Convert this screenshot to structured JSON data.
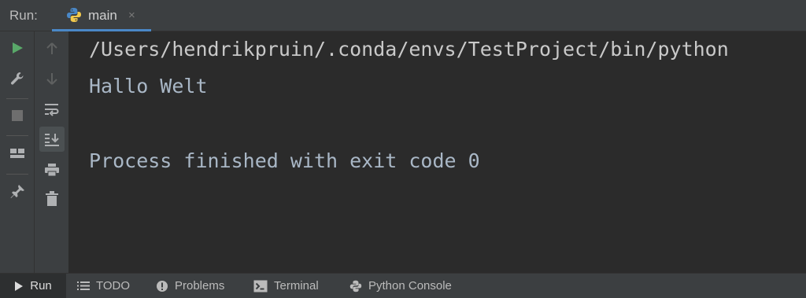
{
  "header": {
    "run_label": "Run:",
    "tab": {
      "name": "main",
      "icon": "python-icon",
      "close": "×"
    }
  },
  "toolbar_left": [
    "rerun-icon",
    "wrench-icon",
    "stop-icon",
    "layout-icon",
    "pin-icon"
  ],
  "toolbar_right": [
    "up-arrow-icon",
    "down-arrow-icon",
    "soft-wrap-icon",
    "scroll-to-end-icon",
    "print-icon",
    "trash-icon"
  ],
  "console": {
    "lines": [
      "/Users/hendrikpruin/.conda/envs/TestProject/bin/python",
      "Hallo Welt",
      "",
      "Process finished with exit code 0"
    ]
  },
  "bottom_tabs": [
    {
      "label": "Run",
      "icon": "play-icon",
      "active": true
    },
    {
      "label": "TODO",
      "icon": "list-icon",
      "active": false
    },
    {
      "label": "Problems",
      "icon": "alert-icon",
      "active": false
    },
    {
      "label": "Terminal",
      "icon": "terminal-icon",
      "active": false
    },
    {
      "label": "Python Console",
      "icon": "python-icon",
      "active": false
    }
  ],
  "colors": {
    "accent": "#4a88c7",
    "run_green": "#59a869",
    "background": "#2b2b2b",
    "panel": "#3c3f41"
  }
}
